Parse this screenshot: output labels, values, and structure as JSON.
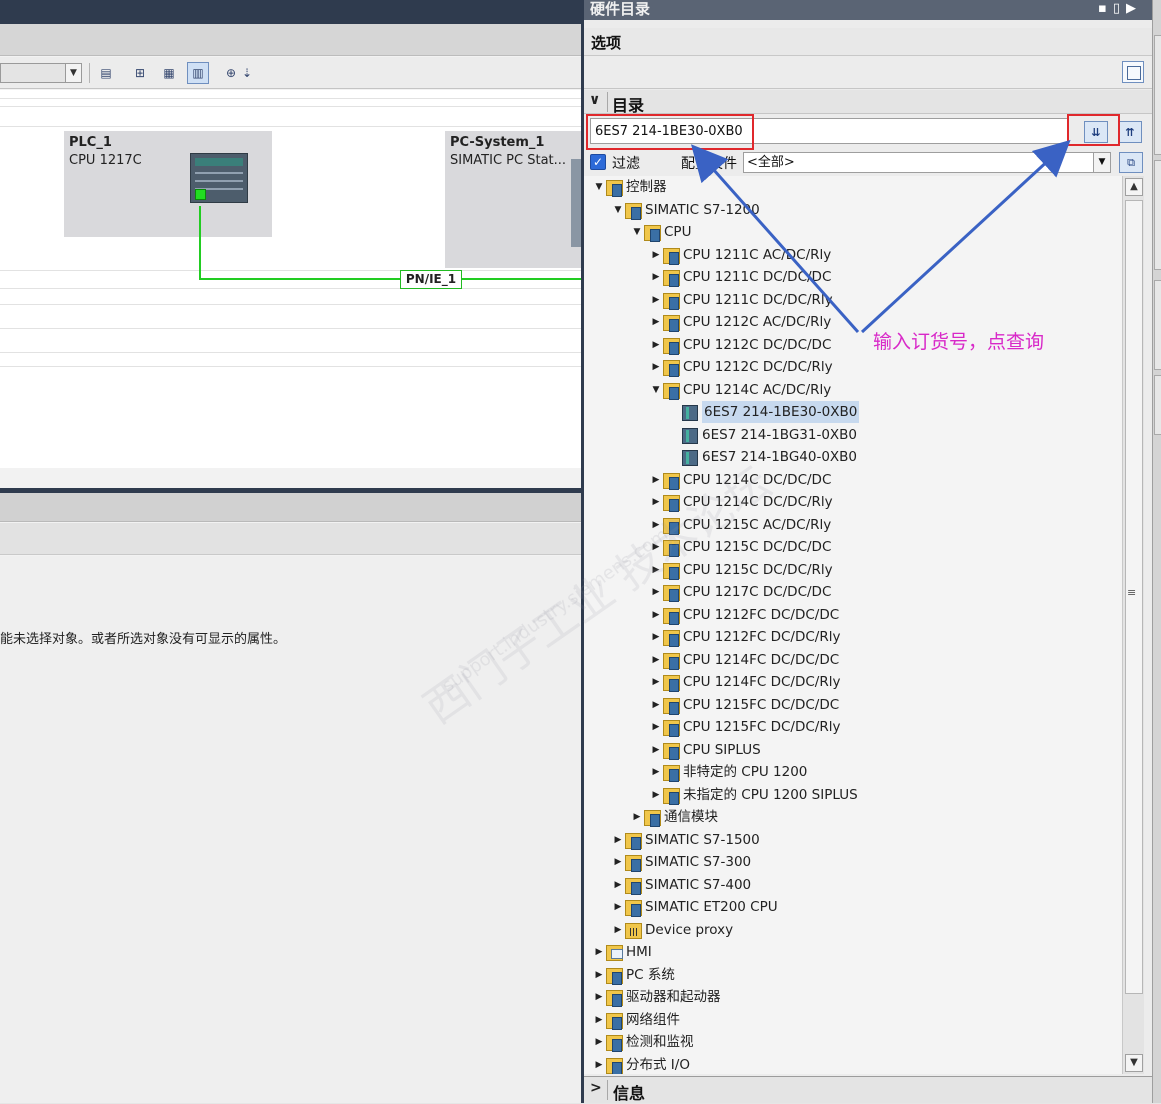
{
  "devices": [
    {
      "name": "PLC_1",
      "type": "CPU 1217C"
    },
    {
      "name": "PC-System_1",
      "type": "SIMATIC PC Stat..."
    }
  ],
  "network": {
    "label": "PN/IE_1",
    "color": "#22cc22"
  },
  "properties_message": "能未选择对象。或者所选对象没有可显示的属性。",
  "panel": {
    "title": "硬件目录",
    "options_label": "选项",
    "catalog_label": "目录",
    "search_value": "6ES7 214-1BE30-0XB0",
    "filter_label": "过滤",
    "filter_checked": true,
    "profile_label": "配置文件",
    "profile_value": "<全部>",
    "info_label": "信息"
  },
  "tree": [
    {
      "label": "控制器",
      "level": 0,
      "icon": "folder-icon",
      "expanded": true
    },
    {
      "label": "SIMATIC S7-1200",
      "level": 1,
      "icon": "folder-icon",
      "expanded": true
    },
    {
      "label": "CPU",
      "level": 2,
      "icon": "folder-icon",
      "expanded": true
    },
    {
      "label": "CPU 1211C AC/DC/Rly",
      "level": 3,
      "icon": "folder-icon",
      "expanded": false
    },
    {
      "label": "CPU 1211C DC/DC/DC",
      "level": 3,
      "icon": "folder-icon",
      "expanded": false
    },
    {
      "label": "CPU 1211C DC/DC/Rly",
      "level": 3,
      "icon": "folder-icon",
      "expanded": false
    },
    {
      "label": "CPU 1212C AC/DC/Rly",
      "level": 3,
      "icon": "folder-icon",
      "expanded": false
    },
    {
      "label": "CPU 1212C DC/DC/DC",
      "level": 3,
      "icon": "folder-icon",
      "expanded": false
    },
    {
      "label": "CPU 1212C DC/DC/Rly",
      "level": 3,
      "icon": "folder-icon",
      "expanded": false
    },
    {
      "label": "CPU 1214C AC/DC/Rly",
      "level": 3,
      "icon": "folder-icon",
      "expanded": true
    },
    {
      "label": "6ES7 214-1BE30-0XB0",
      "level": 4,
      "icon": "module-icon",
      "leaf": true,
      "selected": true
    },
    {
      "label": "6ES7 214-1BG31-0XB0",
      "level": 4,
      "icon": "module-icon",
      "leaf": true
    },
    {
      "label": "6ES7 214-1BG40-0XB0",
      "level": 4,
      "icon": "module-icon",
      "leaf": true
    },
    {
      "label": "CPU 1214C DC/DC/DC",
      "level": 3,
      "icon": "folder-icon",
      "expanded": false
    },
    {
      "label": "CPU 1214C DC/DC/Rly",
      "level": 3,
      "icon": "folder-icon",
      "expanded": false
    },
    {
      "label": "CPU 1215C AC/DC/Rly",
      "level": 3,
      "icon": "folder-icon",
      "expanded": false
    },
    {
      "label": "CPU 1215C DC/DC/DC",
      "level": 3,
      "icon": "folder-icon",
      "expanded": false
    },
    {
      "label": "CPU 1215C DC/DC/Rly",
      "level": 3,
      "icon": "folder-icon",
      "expanded": false
    },
    {
      "label": "CPU 1217C DC/DC/DC",
      "level": 3,
      "icon": "folder-icon",
      "expanded": false
    },
    {
      "label": "CPU 1212FC DC/DC/DC",
      "level": 3,
      "icon": "folder-icon",
      "expanded": false
    },
    {
      "label": "CPU 1212FC DC/DC/Rly",
      "level": 3,
      "icon": "folder-icon",
      "expanded": false
    },
    {
      "label": "CPU 1214FC DC/DC/DC",
      "level": 3,
      "icon": "folder-icon",
      "expanded": false
    },
    {
      "label": "CPU 1214FC DC/DC/Rly",
      "level": 3,
      "icon": "folder-icon",
      "expanded": false
    },
    {
      "label": "CPU 1215FC DC/DC/DC",
      "level": 3,
      "icon": "folder-icon",
      "expanded": false
    },
    {
      "label": "CPU 1215FC DC/DC/Rly",
      "level": 3,
      "icon": "folder-icon",
      "expanded": false
    },
    {
      "label": "CPU SIPLUS",
      "level": 3,
      "icon": "folder-icon",
      "expanded": false
    },
    {
      "label": "非特定的 CPU 1200",
      "level": 3,
      "icon": "folder-icon",
      "expanded": false
    },
    {
      "label": "未指定的 CPU 1200 SIPLUS",
      "level": 3,
      "icon": "folder-icon",
      "expanded": false
    },
    {
      "label": "通信模块",
      "level": 2,
      "icon": "folder-icon",
      "expanded": false
    },
    {
      "label": "SIMATIC S7-1500",
      "level": 1,
      "icon": "folder-icon",
      "expanded": false
    },
    {
      "label": "SIMATIC S7-300",
      "level": 1,
      "icon": "folder-icon",
      "expanded": false
    },
    {
      "label": "SIMATIC S7-400",
      "level": 1,
      "icon": "folder-icon",
      "expanded": false
    },
    {
      "label": "SIMATIC ET200 CPU",
      "level": 1,
      "icon": "folder-icon",
      "expanded": false
    },
    {
      "label": "Device proxy",
      "level": 1,
      "icon": "proxy-icon",
      "expanded": false
    },
    {
      "label": "HMI",
      "level": 0,
      "icon": "hmi-icon",
      "expanded": false
    },
    {
      "label": "PC 系统",
      "level": 0,
      "icon": "folder-icon",
      "expanded": false
    },
    {
      "label": "驱动器和起动器",
      "level": 0,
      "icon": "folder-icon",
      "expanded": false
    },
    {
      "label": "网络组件",
      "level": 0,
      "icon": "folder-icon",
      "expanded": false
    },
    {
      "label": "检测和监视",
      "level": 0,
      "icon": "folder-icon",
      "expanded": false
    },
    {
      "label": "分布式 I/O",
      "level": 0,
      "icon": "folder-icon",
      "expanded": false
    }
  ],
  "annotation": {
    "text": "输入订货号，点查询",
    "color": "#d828c8",
    "highlight_color": "#e0282c"
  },
  "watermark": {
    "text": "西门子工业 技术论坛",
    "url_text": "support.industry.siemens.com"
  },
  "colors": {
    "title_bar": "#2f3b4e",
    "selection": "#c7d9ee",
    "accent": "#3a62c4"
  }
}
